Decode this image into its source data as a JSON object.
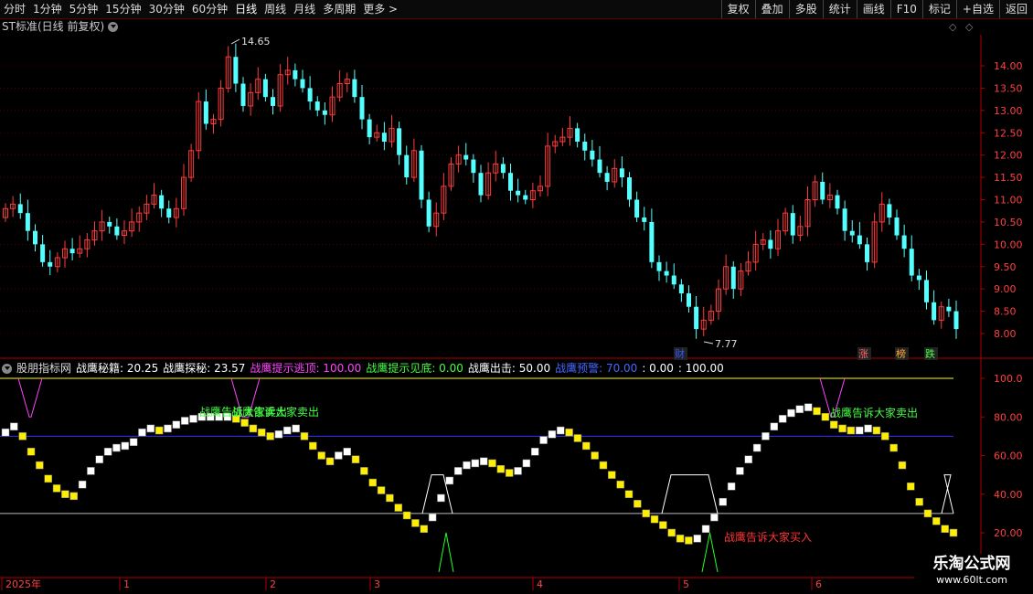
{
  "toolbar": {
    "periods": [
      "分时",
      "1分钟",
      "5分钟",
      "15分钟",
      "30分钟",
      "60分钟",
      "日线",
      "周线",
      "月线",
      "多周期",
      "更多 >"
    ],
    "active": "日线",
    "buttons": [
      "复权",
      "叠加",
      "多股",
      "统计",
      "画线",
      "F10",
      "标记",
      "+自选",
      "返回"
    ]
  },
  "main_panel": {
    "title": "ST标准(日线 前复权)",
    "high_label": "14.65",
    "low_label": "7.77",
    "badges": [
      "财",
      "涨",
      "榜",
      "跌"
    ],
    "price_axis": [
      "14.00",
      "13.50",
      "13.00",
      "12.50",
      "12.00",
      "11.50",
      "11.00",
      "10.50",
      "10.00",
      "9.50",
      "9.00",
      "8.50",
      "8.00"
    ]
  },
  "indicator_panel": {
    "name": "股朋指标网",
    "fields": [
      {
        "label": "战鹰秘籍:",
        "value": "20.25",
        "color": "#ffffff"
      },
      {
        "label": "战鹰探秘:",
        "value": "23.57",
        "color": "#ffffff"
      },
      {
        "label": "战鹰提示逃顶:",
        "value": "100.00",
        "color": "#ff44ff"
      },
      {
        "label": "战鹰提示见底:",
        "value": "0.00",
        "color": "#44ff44"
      },
      {
        "label": "战鹰出击:",
        "value": "50.00",
        "color": "#ffffff"
      },
      {
        "label": "战鹰预警:",
        "value": "70.00",
        "color": "#4466ff"
      },
      {
        "label": ":",
        "value": "0.00",
        "color": "#ffffff"
      },
      {
        "label": ":",
        "value": "100.00",
        "color": "#ffffff"
      }
    ],
    "axis": [
      "100.0",
      "80.00",
      "60.00",
      "40.00",
      "20.00"
    ],
    "annotations": [
      {
        "text": "战鹰告诉大家卖出",
        "color": "#44ff44"
      },
      {
        "text": "战鹰告诉大家卖出",
        "color": "#44ff44"
      },
      {
        "text": "战鹰告诉大家卖出",
        "color": "#44ff44"
      },
      {
        "text": "战鹰告诉大家买入",
        "color": "#ff3333"
      }
    ]
  },
  "time_axis": {
    "labels": [
      "2025年",
      "1",
      "2",
      "3",
      "4",
      "5",
      "6"
    ]
  },
  "watermark": {
    "line1": "乐淘公式网",
    "line2": "www.60lt.com"
  },
  "colors": {
    "up": "#ff3b3b",
    "down": "#54ffff",
    "grid": "#7a0000",
    "axis": "#b00000"
  }
}
